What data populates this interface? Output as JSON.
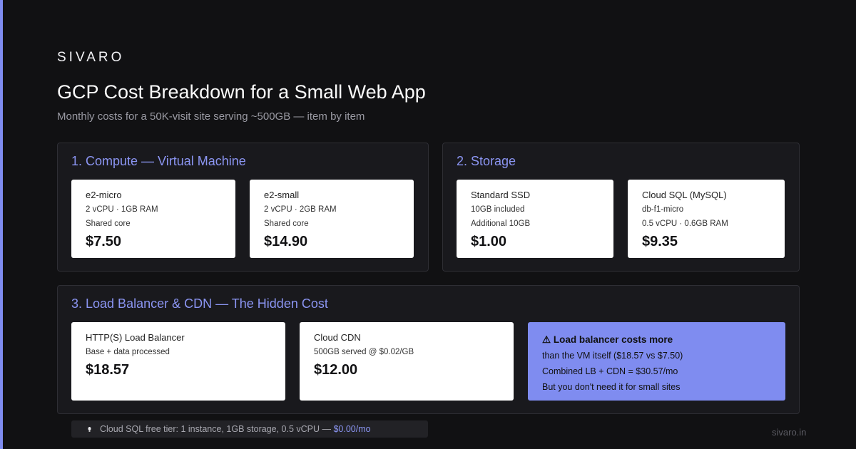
{
  "brand": "SIVARO",
  "title": "GCP Cost Breakdown for a Small Web App",
  "subtitle": "Monthly costs for a 50K-visit site serving ~500GB — item by item",
  "sections": [
    {
      "title": "1. Compute — Virtual Machine",
      "cards": [
        {
          "name": "e2-micro",
          "lines": [
            "2 vCPU · 1GB RAM",
            "Shared core"
          ],
          "price": "$7.50"
        },
        {
          "name": "e2-small",
          "lines": [
            "2 vCPU · 2GB RAM",
            "Shared core"
          ],
          "price": "$14.90"
        }
      ]
    },
    {
      "title": "2. Storage",
      "cards": [
        {
          "name": "Standard SSD",
          "lines": [
            "10GB included",
            "Additional 10GB"
          ],
          "price": "$1.00"
        },
        {
          "name": "Cloud SQL (MySQL)",
          "lines": [
            "db-f1-micro",
            "0.5 vCPU · 0.6GB RAM"
          ],
          "price": "$9.35"
        }
      ]
    },
    {
      "title": "3. Load Balancer & CDN — The Hidden Cost",
      "cards": [
        {
          "name": "HTTP(S) Load Balancer",
          "lines": [
            "Base + data processed"
          ],
          "price": "$18.57"
        },
        {
          "name": "Cloud CDN",
          "lines": [
            "500GB served @ $0.02/GB"
          ],
          "price": "$12.00"
        }
      ],
      "callout": {
        "icon": "warning-icon",
        "icon_glyph": "⚠",
        "head": "Load balancer costs more",
        "lines": [
          "than the VM itself ($18.57 vs $7.50)",
          "Combined LB + CDN = $30.57/mo",
          "But you don't need it for small sites"
        ]
      }
    }
  ],
  "footnote": {
    "icon": "lightbulb-icon",
    "text": "Cloud SQL free tier: 1 instance, 1GB storage, 0.5 vCPU — ",
    "highlight": "$0.00/mo"
  },
  "domain": "sivaro.in",
  "colors": {
    "accent": "#7f8cf0",
    "background": "#111113",
    "panel": "#19191d"
  }
}
